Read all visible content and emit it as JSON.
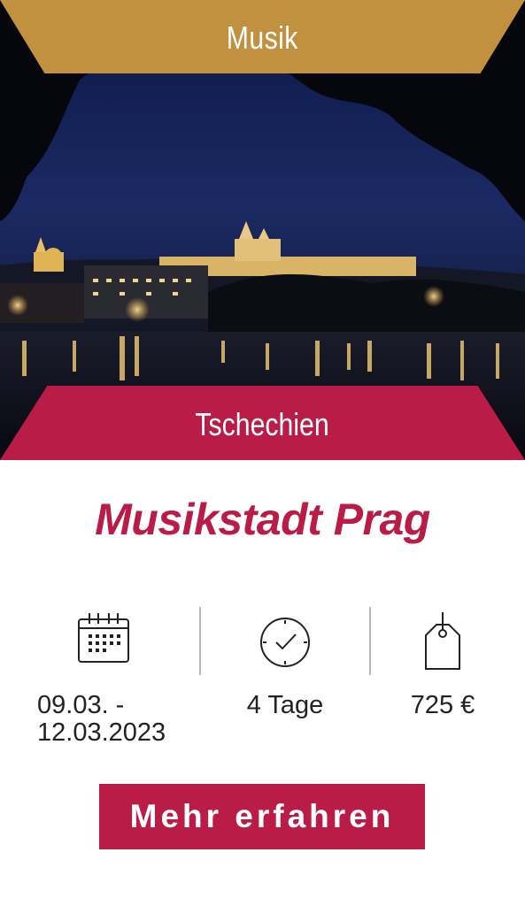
{
  "colors": {
    "gold": "#C2913F",
    "crimson": "#B81C47",
    "text_dark": "#222222",
    "white": "#FFFFFF"
  },
  "category": {
    "label": "Musik"
  },
  "country": {
    "label": "Tschechien"
  },
  "photo": {
    "icon": "night-city-photo"
  },
  "trip": {
    "title": "Musikstadt Prag"
  },
  "details": {
    "date": {
      "icon": "calendar-icon",
      "line1": "09.03. -",
      "line2": "12.03.2023"
    },
    "duration": {
      "icon": "clock-icon",
      "label": "4 Tage"
    },
    "price": {
      "icon": "price-tag-icon",
      "label": "725 €"
    }
  },
  "cta": {
    "label": "Mehr erfahren"
  }
}
